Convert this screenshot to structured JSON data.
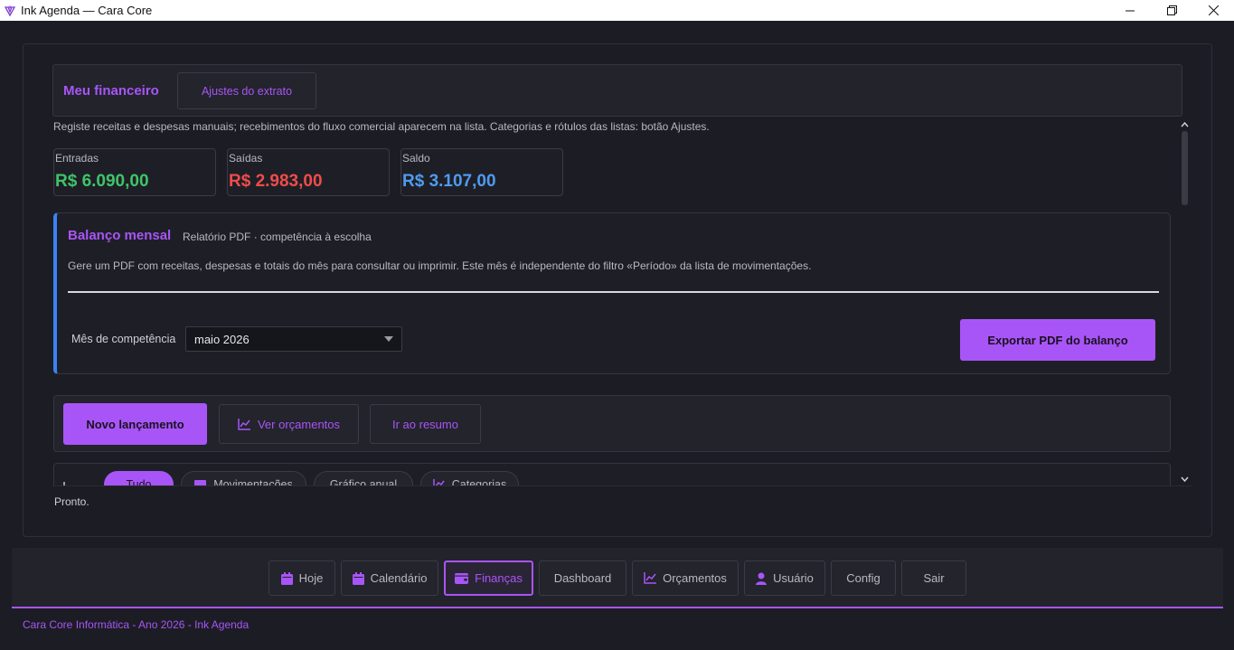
{
  "window": {
    "title": "Ink Agenda — Cara Core",
    "controls": [
      "minimize-icon",
      "restore-icon",
      "close-icon"
    ]
  },
  "header": {
    "title": "Meu financeiro",
    "ajustes_label": "Ajustes do extrato",
    "hint": "Registe receitas e despesas manuais; recebimentos do fluxo comercial aparecem na lista. Categorias e rótulos das listas: botão Ajustes."
  },
  "stats": [
    {
      "label": "Entradas",
      "value": "R$ 6.090,00",
      "color": "#3fc46a"
    },
    {
      "label": "Saídas",
      "value": "R$ 2.983,00",
      "color": "#ef4c4c"
    },
    {
      "label": "Saldo",
      "value": "R$ 3.107,00",
      "color": "#4f9bf0"
    }
  ],
  "balanco": {
    "title": "Balanço mensal",
    "subtitle": "Relatório PDF · competência à escolha",
    "description": "Gere um PDF com receitas, despesas e totais do mês para consultar ou imprimir. Este mês é independente do filtro «Período» da lista de movimentações.",
    "mes_label": "Mês de competência",
    "mes_value": "maio 2026",
    "export_label": "Exportar PDF do balanço",
    "accent": "#3b82f6"
  },
  "actions": {
    "novo_label": "Novo lançamento",
    "orcamentos_label": "Ver orçamentos",
    "resumo_label": "Ir ao resumo"
  },
  "tabs": [
    {
      "label": "Tudo",
      "icon": "",
      "active": true
    },
    {
      "label": "Movimentações",
      "icon": "list-icon",
      "active": false
    },
    {
      "label": "Gráfico anual",
      "icon": "",
      "active": false
    },
    {
      "label": "Categorias",
      "icon": "chart-icon",
      "active": false
    }
  ],
  "status": "Pronto.",
  "nav": {
    "items": [
      {
        "label": "Hoje",
        "icon": "calendar-icon",
        "active": false
      },
      {
        "label": "Calendário",
        "icon": "calendar-icon",
        "active": false
      },
      {
        "label": "Finanças",
        "icon": "wallet-icon",
        "active": true
      },
      {
        "label": "Dashboard",
        "icon": "",
        "active": false
      },
      {
        "label": "Orçamentos",
        "icon": "chart-icon",
        "active": false
      },
      {
        "label": "Usuário",
        "icon": "user-icon",
        "active": false
      },
      {
        "label": "Config",
        "icon": "",
        "active": false
      },
      {
        "label": "Sair",
        "icon": "",
        "active": false
      }
    ]
  },
  "footer": "Cara Core Informática - Ano 2026 - Ink Agenda",
  "colors": {
    "accent": "#a855f7",
    "background": "#1c1d24"
  }
}
